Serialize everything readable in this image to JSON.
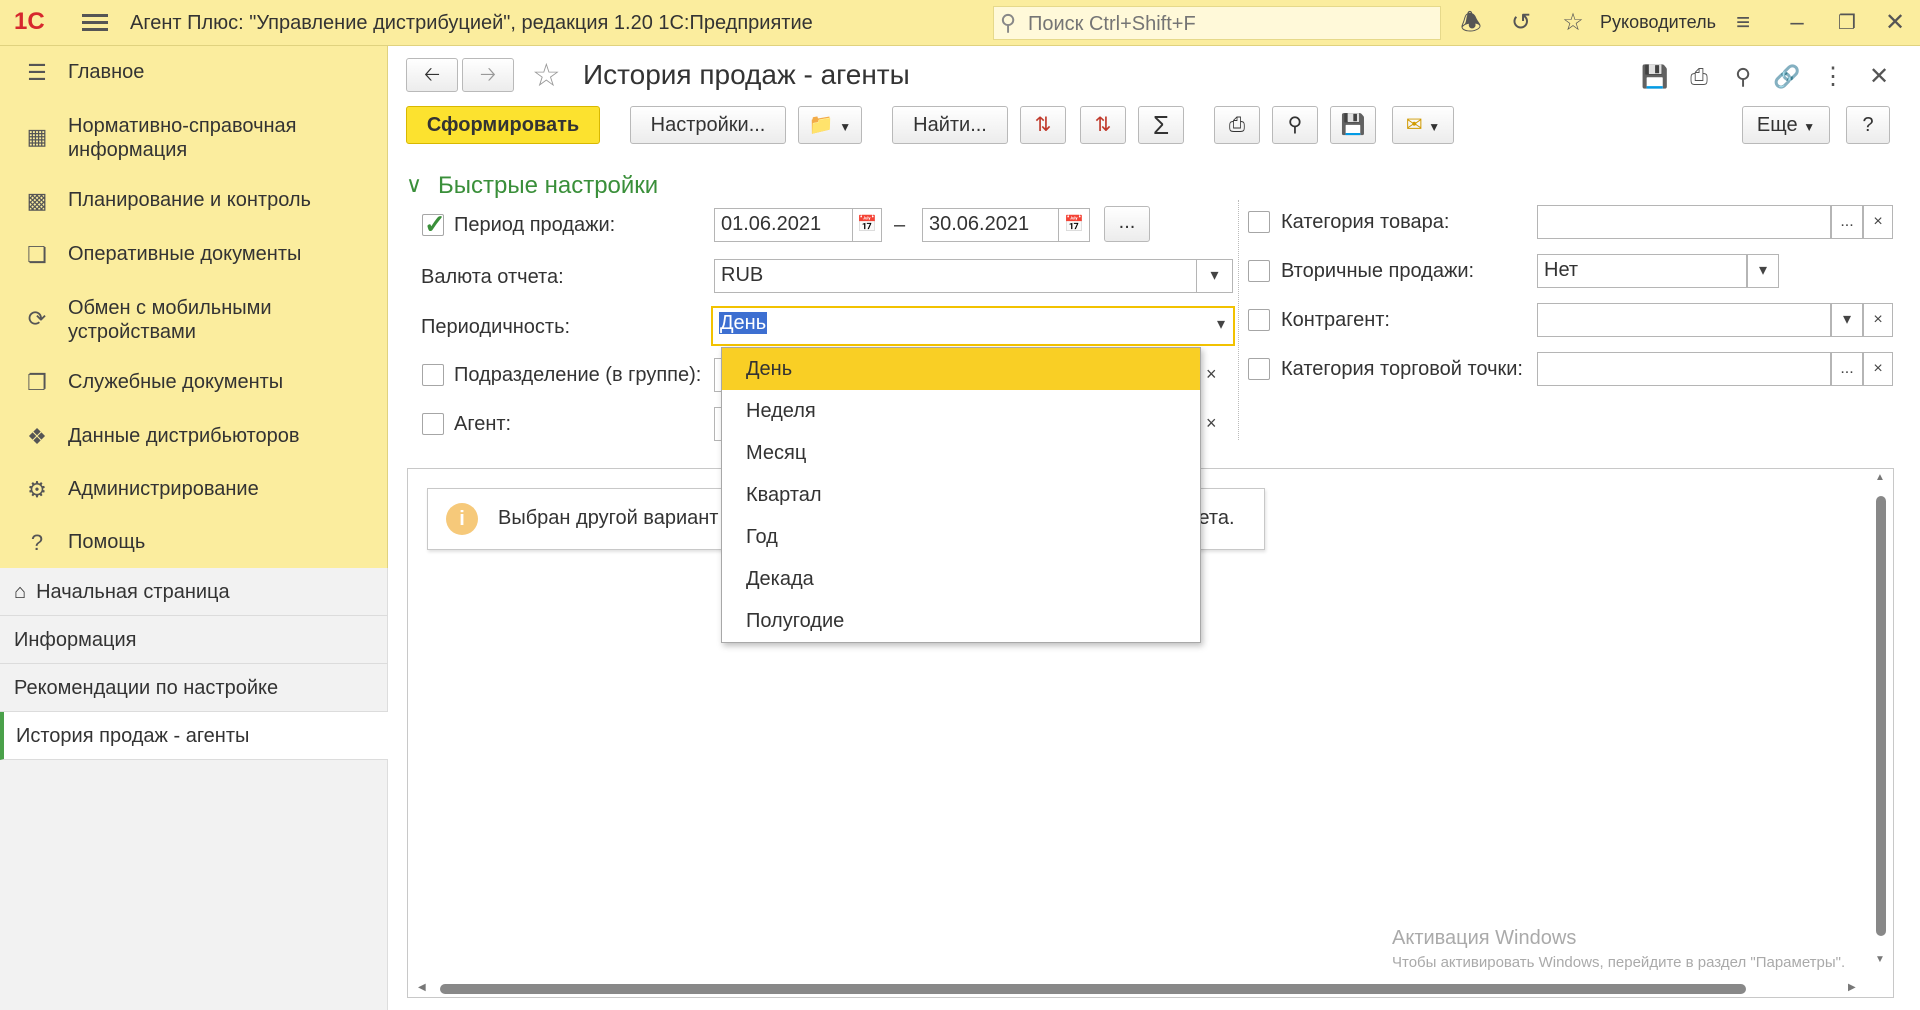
{
  "titlebar": {
    "logo": "1С",
    "title": "Агент Плюс: \"Управление дистрибуцией\", редакция 1.20 1С:Предприятие",
    "search_placeholder": "Поиск Ctrl+Shift+F",
    "user": "Руководитель"
  },
  "sidebar": {
    "items": [
      {
        "label": "Главное",
        "icon": "menu-icon"
      },
      {
        "label": "Нормативно-справочная информация",
        "icon": "catalog-icon"
      },
      {
        "label": "Планирование и контроль",
        "icon": "chart-icon"
      },
      {
        "label": "Оперативные документы",
        "icon": "documents-icon"
      },
      {
        "label": "Обмен с мобильными устройствами",
        "icon": "sync-icon"
      },
      {
        "label": "Служебные документы",
        "icon": "service-docs-icon"
      },
      {
        "label": "Данные дистрибьюторов",
        "icon": "distributor-icon"
      },
      {
        "label": "Администрирование",
        "icon": "gear-icon"
      },
      {
        "label": "Помощь",
        "icon": "help-icon"
      }
    ]
  },
  "nav": {
    "items": [
      "Начальная страница",
      "Информация",
      "Рекомендации по настройке",
      "История продаж - агенты"
    ]
  },
  "page": {
    "title": "История продаж - агенты"
  },
  "toolbar": {
    "generate": "Сформировать",
    "settings": "Настройки...",
    "find": "Найти...",
    "more": "Еще",
    "help": "?",
    "ellipsis": "..."
  },
  "quick_settings": {
    "title": "Быстрые настройки",
    "period_label": "Период продажи:",
    "period_enabled": true,
    "date_from": "01.06.2021",
    "date_to": "30.06.2021",
    "dash": "–",
    "currency_label": "Валюта отчета:",
    "currency_value": "RUB",
    "periodicity_label": "Периодичность:",
    "periodicity_value": "День",
    "department_label": "Подразделение (в группе):",
    "agent_label": "Агент:",
    "product_category_label": "Категория товара:",
    "secondary_sales_label": "Вторичные продажи:",
    "secondary_sales_value": "Нет",
    "counterparty_label": "Контрагент:",
    "outlet_category_label": "Категория торговой точки:"
  },
  "dropdown": {
    "options": [
      "День",
      "Неделя",
      "Месяц",
      "Квартал",
      "Год",
      "Декада",
      "Полугодие"
    ],
    "selected": "День"
  },
  "report": {
    "info_left": "Выбран другой вариант",
    "info_right": "чета."
  },
  "watermark": {
    "line1": "Активация Windows",
    "line2": "Чтобы активировать Windows, перейдите в раздел \"Параметры\"."
  },
  "colors": {
    "sidebar_bg": "#fbed9e",
    "primary_button": "#fce22f",
    "dropdown_selected": "#f9cf25",
    "accent_green": "#3a8f3a"
  }
}
